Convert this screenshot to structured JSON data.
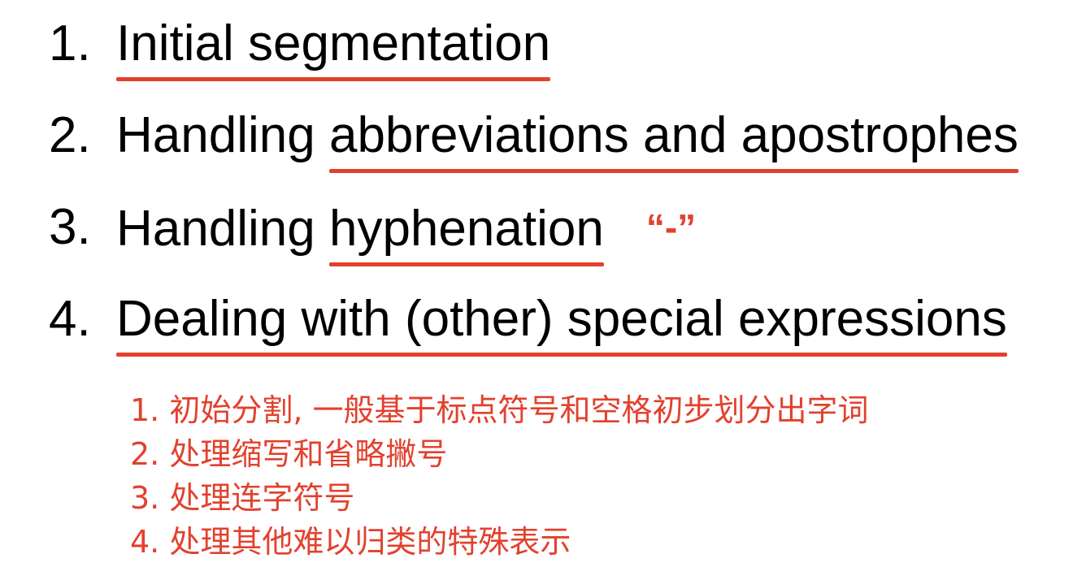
{
  "main_items": [
    {
      "number": "1.",
      "prefix": "",
      "highlight": "Initial segmentation",
      "suffix": ""
    },
    {
      "number": "2.",
      "prefix": "Handling ",
      "highlight": "abbreviations and apostrophes",
      "suffix": ""
    },
    {
      "number": "3.",
      "prefix": "Handling ",
      "highlight": "hyphenation",
      "suffix": "“-”"
    },
    {
      "number": "4.",
      "prefix": "",
      "highlight": "Dealing with (other) special expressions",
      "suffix": ""
    }
  ],
  "sub_items": [
    "1. 初始分割, 一般基于标点符号和空格初步划分出字词",
    "2. 处理缩写和省略撇号",
    "3. 处理连字符号",
    "4. 处理其他难以归类的特殊表示"
  ],
  "colors": {
    "accent": "#e2412e",
    "text": "#000000",
    "background": "#ffffff"
  }
}
